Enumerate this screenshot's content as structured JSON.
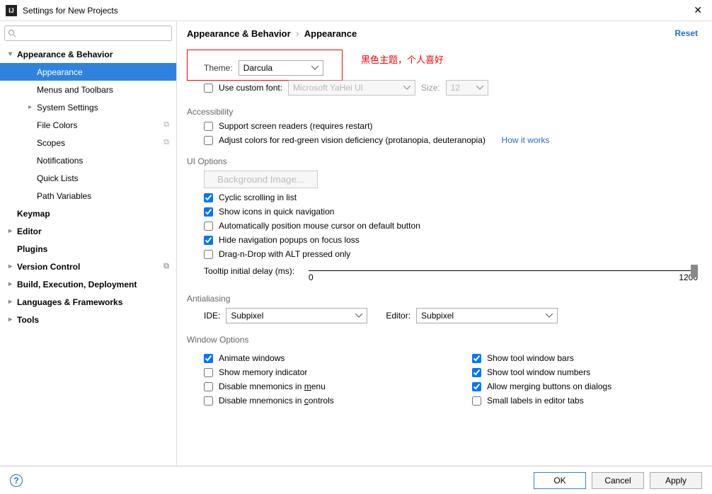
{
  "window": {
    "title": "Settings for New Projects"
  },
  "sidebar": {
    "search_placeholder": "",
    "items": [
      {
        "label": "Appearance & Behavior",
        "level": 1,
        "expanded": true,
        "name": "appearance-behavior"
      },
      {
        "label": "Appearance",
        "level": 2,
        "selected": true,
        "name": "appearance"
      },
      {
        "label": "Menus and Toolbars",
        "level": 2,
        "name": "menus-toolbars"
      },
      {
        "label": "System Settings",
        "level": 2,
        "expandable": true,
        "name": "system-settings"
      },
      {
        "label": "File Colors",
        "level": 2,
        "name": "file-colors",
        "copyable": true
      },
      {
        "label": "Scopes",
        "level": 2,
        "name": "scopes",
        "copyable": true
      },
      {
        "label": "Notifications",
        "level": 2,
        "name": "notifications"
      },
      {
        "label": "Quick Lists",
        "level": 2,
        "name": "quick-lists"
      },
      {
        "label": "Path Variables",
        "level": 2,
        "name": "path-variables"
      },
      {
        "label": "Keymap",
        "level": 1,
        "name": "keymap"
      },
      {
        "label": "Editor",
        "level": 1,
        "expandable": true,
        "name": "editor"
      },
      {
        "label": "Plugins",
        "level": 1,
        "name": "plugins"
      },
      {
        "label": "Version Control",
        "level": 1,
        "expandable": true,
        "name": "version-control",
        "copyable": true
      },
      {
        "label": "Build, Execution, Deployment",
        "level": 1,
        "expandable": true,
        "name": "build-exec-deploy"
      },
      {
        "label": "Languages & Frameworks",
        "level": 1,
        "expandable": true,
        "name": "lang-frameworks"
      },
      {
        "label": "Tools",
        "level": 1,
        "expandable": true,
        "name": "tools"
      }
    ]
  },
  "breadcrumb": {
    "a": "Appearance & Behavior",
    "b": "Appearance"
  },
  "reset": "Reset",
  "annotation": "黑色主题，个人喜好",
  "theme": {
    "label": "Theme:",
    "value": "Darcula"
  },
  "custom_font": {
    "label": "Use custom font:",
    "font_value": "Microsoft YaHei UI",
    "size_label": "Size:",
    "size_value": "12"
  },
  "acc": {
    "title": "Accessibility",
    "screen_readers": "Support screen readers (requires restart)",
    "color_def": "Adjust colors for red-green vision deficiency (protanopia, deuteranopia)",
    "how": "How it works"
  },
  "ui": {
    "title": "UI Options",
    "bg_image": "Background Image...",
    "cyclic": "Cyclic scrolling in list",
    "icons_nav": "Show icons in quick navigation",
    "auto_cursor": "Automatically position mouse cursor on default button",
    "hide_popups": "Hide navigation popups on focus loss",
    "dnd_alt": "Drag-n-Drop with ALT pressed only",
    "tooltip_label": "Tooltip initial delay (ms):",
    "tooltip_min": "0",
    "tooltip_max": "1200"
  },
  "aa": {
    "title": "Antialiasing",
    "ide_label": "IDE:",
    "ide_value": "Subpixel",
    "editor_label": "Editor:",
    "editor_value": "Subpixel"
  },
  "wo": {
    "title": "Window Options",
    "animate": "Animate windows",
    "memory": "Show memory indicator",
    "dis_menu_pre": "Disable mnemonics in ",
    "dis_menu_u": "m",
    "dis_menu_post": "enu",
    "dis_ctrl_pre": "Disable mnemonics in ",
    "dis_ctrl_u": "c",
    "dis_ctrl_post": "ontrols",
    "tool_bars": "Show tool window bars",
    "tool_nums": "Show tool window numbers",
    "merge_btns": "Allow merging buttons on dialogs",
    "small_labels": "Small labels in editor tabs"
  },
  "footer": {
    "ok": "OK",
    "cancel": "Cancel",
    "apply": "Apply"
  }
}
